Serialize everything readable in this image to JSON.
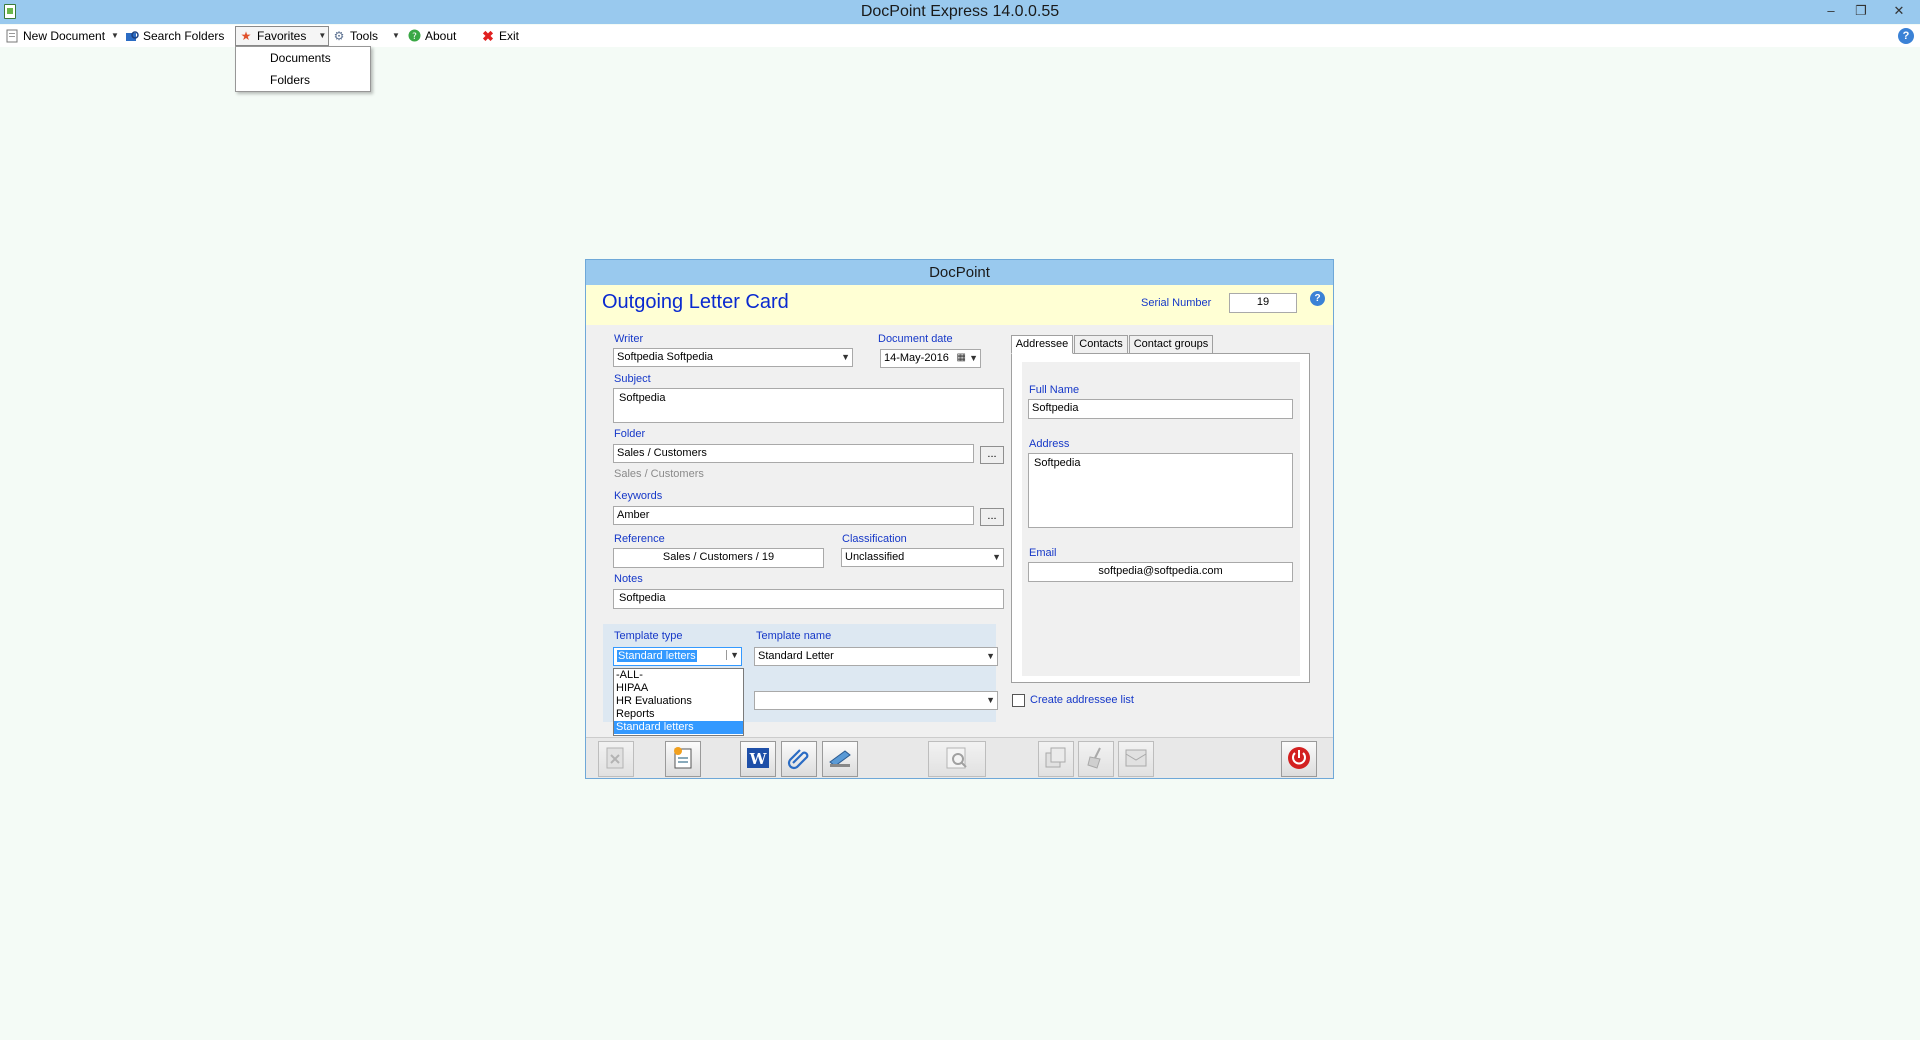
{
  "window": {
    "title": "DocPoint Express   14.0.0.55",
    "minimize": "–",
    "restore": "❐",
    "close": "✕"
  },
  "menu": {
    "new_document": "New Document",
    "search_folders": "Search Folders",
    "favorites": "Favorites",
    "tools": "Tools",
    "about": "About",
    "exit": "Exit",
    "help": "?"
  },
  "favorites_menu": {
    "documents": "Documents",
    "folders": "Folders"
  },
  "dialog": {
    "title": "DocPoint",
    "card_title": "Outgoing Letter Card",
    "serial_label": "Serial Number",
    "serial_value": "19",
    "help": "?",
    "writer_label": "Writer",
    "writer_value": "Softpedia Softpedia",
    "doc_date_label": "Document date",
    "doc_date_value": "14-May-2016",
    "subject_label": "Subject",
    "subject_value": "Softpedia",
    "folder_label": "Folder",
    "folder_value": "Sales / Customers",
    "folder_path": "Sales / Customers",
    "browse": "...",
    "keywords_label": "Keywords",
    "keywords_value": "Amber",
    "reference_label": "Reference",
    "reference_value": "Sales / Customers / 19",
    "classification_label": "Classification",
    "classification_value": "Unclassified",
    "notes_label": "Notes",
    "notes_value": "Softpedia",
    "template_type_label": "Template type",
    "template_type_value": "Standard letters",
    "template_name_label": "Template name",
    "template_name_value": "Standard Letter",
    "template_type_options": [
      "-ALL-",
      "HIPAA",
      "HR Evaluations",
      "Reports",
      "Standard letters"
    ],
    "tabs": [
      "Addressee",
      "Contacts",
      "Contact groups"
    ],
    "full_name_label": "Full Name",
    "full_name_value": "Softpedia",
    "address_label": "Address",
    "address_value": "Softpedia",
    "email_label": "Email",
    "email_value": "softpedia@softpedia.com",
    "create_list_label": "Create addressee list"
  },
  "colors": {
    "title_bar": "#99c9ee",
    "header_bg": "#ffffd4",
    "label_blue": "#1638c8",
    "selection": "#3399ff"
  }
}
